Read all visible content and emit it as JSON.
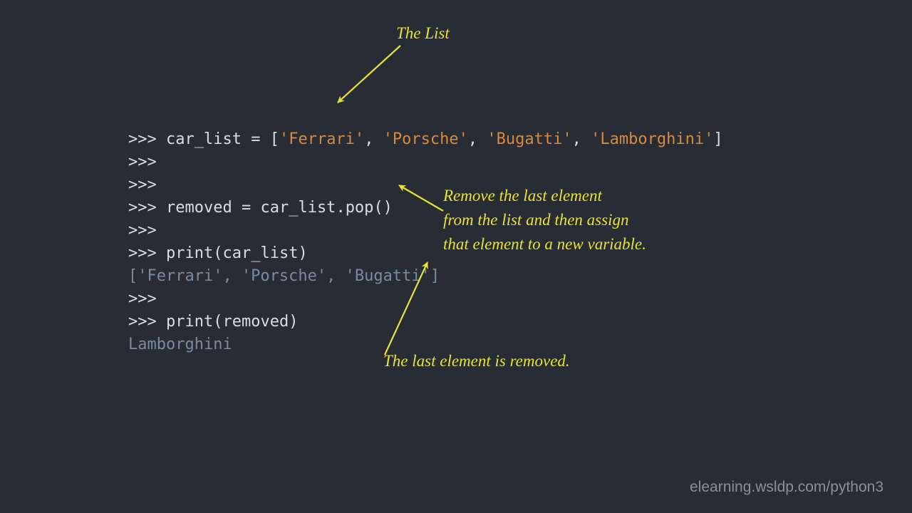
{
  "code": {
    "prompt": ">>>",
    "line1_var": "car_list",
    "line1_eq": " = ",
    "line1_open": "[",
    "line1_s1": "'Ferrari'",
    "line1_c1": ", ",
    "line1_s2": "'Porsche'",
    "line1_c2": ", ",
    "line1_s3": "'Bugatti'",
    "line1_c3": ", ",
    "line1_s4": "'Lamborghini'",
    "line1_close": "]",
    "line4_var": "removed",
    "line4_eq": " = ",
    "line4_obj": "car_list",
    "line4_dot": ".",
    "line4_method": "pop",
    "line4_paren": "()",
    "line6_fn": "print",
    "line6_po": "(",
    "line6_arg": "car_list",
    "line6_pc": ")",
    "line7_output": "['Ferrari', 'Porsche', 'Bugatti']",
    "line9_fn": "print",
    "line9_po": "(",
    "line9_arg": "removed",
    "line9_pc": ")",
    "line10_output": "Lamborghini"
  },
  "annot": {
    "a1": "The List",
    "a2_l1": "Remove the last element",
    "a2_l2": "from the list and then assign",
    "a2_l3": "that element to a new variable.",
    "a3": "The last element is removed."
  },
  "footer": "elearning.wsldp.com/python3",
  "colors": {
    "bg": "#282c34",
    "text": "#d9dde3",
    "string": "#d88a3f",
    "output": "#7a8aa0",
    "annot": "#e7e233",
    "footer": "#8a8f99"
  }
}
